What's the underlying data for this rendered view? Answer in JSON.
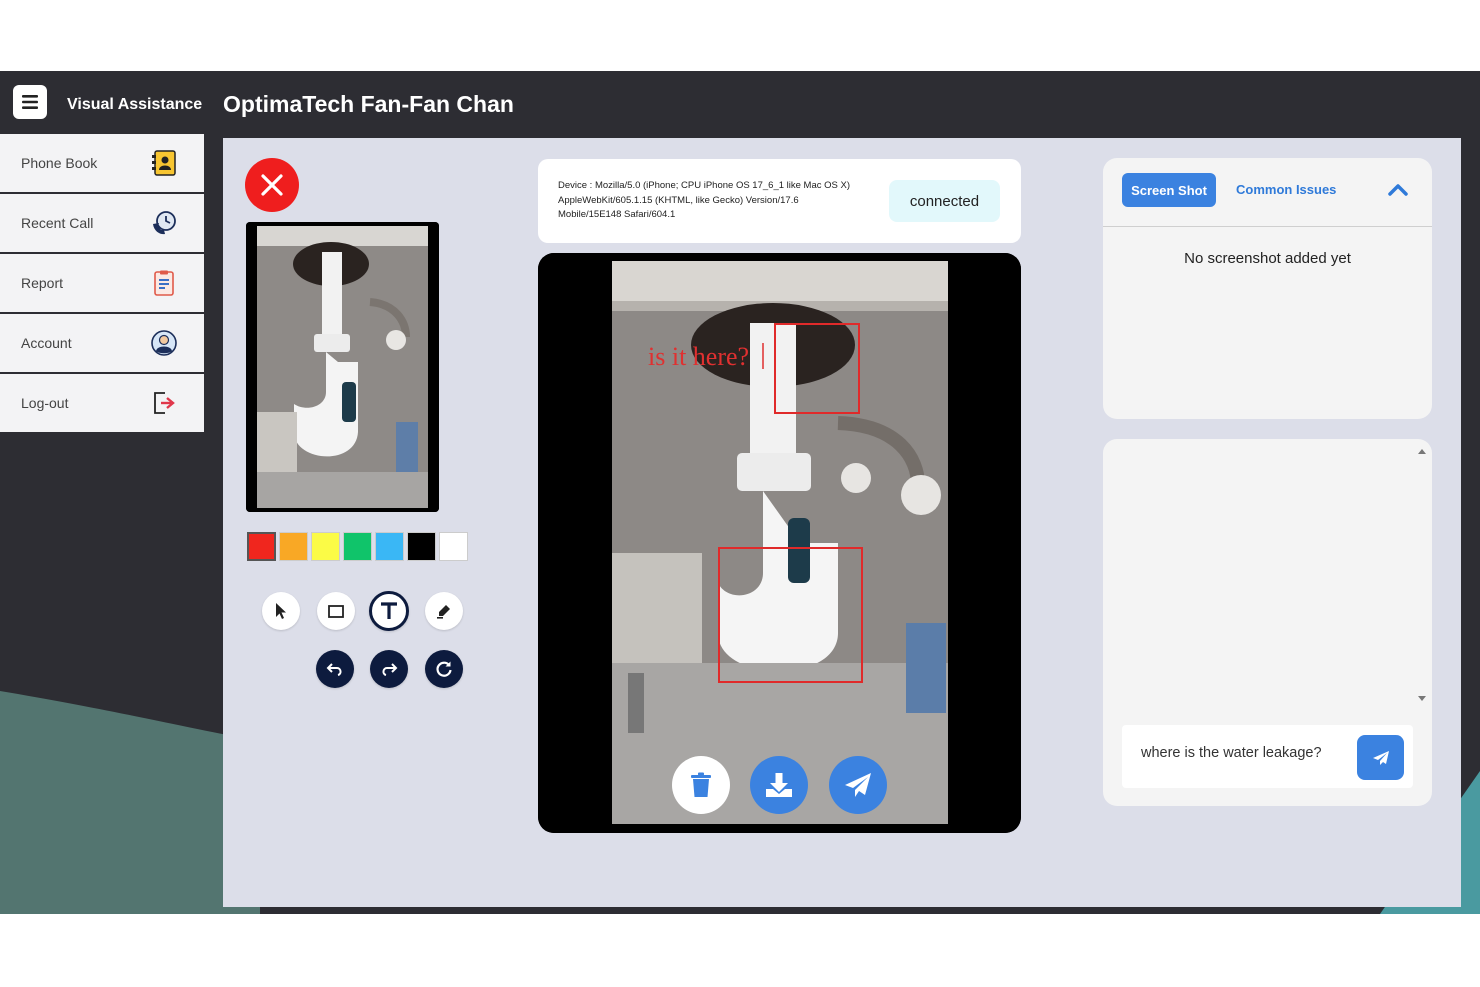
{
  "header": {
    "app_name": "Visual Assistance",
    "page_title": "OptimaTech Fan-Fan Chan"
  },
  "sidebar": {
    "items": [
      {
        "label": "Phone Book",
        "icon": "phone-book-icon"
      },
      {
        "label": "Recent Call",
        "icon": "recent-call-icon"
      },
      {
        "label": "Report",
        "icon": "report-icon"
      },
      {
        "label": "Account",
        "icon": "account-icon"
      },
      {
        "label": "Log-out",
        "icon": "logout-icon"
      }
    ]
  },
  "toolbox": {
    "colors": [
      "#f0261e",
      "#f9a825",
      "#fbfb46",
      "#10c46a",
      "#3ab7f5",
      "#000000",
      "#ffffff"
    ],
    "selected_color": "#f0261e",
    "tools": [
      "pointer-icon",
      "rectangle-icon",
      "text-icon",
      "marker-icon"
    ],
    "active_tool": "text-icon",
    "actions": [
      "undo-icon",
      "redo-icon",
      "refresh-icon"
    ]
  },
  "device": {
    "info": "Device : Mozilla/5.0 (iPhone; CPU iPhone OS 17_6_1 like Mac OS X) AppleWebKit/605.1.15 (KHTML, like Gecko) Version/17.6 Mobile/15E148 Safari/604.1",
    "status": "connected"
  },
  "annotation": {
    "text": "is it here?",
    "color": "#e03030"
  },
  "screenshots": {
    "tab_active": "Screen Shot",
    "tab_other": "Common Issues",
    "empty_text": "No screenshot added yet"
  },
  "chat": {
    "input_value": "where is the water leakage?"
  },
  "colors": {
    "accent": "#3b82e0",
    "close": "#ef1e1e",
    "dark_navy": "#0d1b3e",
    "topbar": "#2d2d33",
    "panel_bg": "#dcdee9"
  }
}
